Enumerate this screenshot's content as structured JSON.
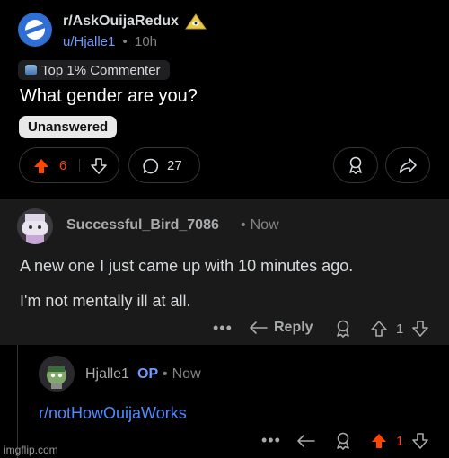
{
  "post": {
    "subreddit": "r/AskOuijaRedux",
    "username": "u/Hjalle1",
    "separator": "•",
    "age": "10h",
    "flair": "Top 1% Commenter",
    "title": "What gender are you?",
    "tag": "Unanswered",
    "vote_count": "6",
    "comment_count": "27",
    "upvoted": true
  },
  "comment": {
    "author": "Successful_Bird_7086",
    "separator": "•",
    "time": "Now",
    "line1": "A new one I just came up with 10 minutes ago.",
    "line2": "I'm not mentally ill at all.",
    "more": "•••",
    "reply_label": "Reply",
    "vote_count": "1"
  },
  "reply": {
    "author": "Hjalle1",
    "op_badge": "OP",
    "separator": "•",
    "time": "Now",
    "body": "r/notHowOuijaWorks",
    "more": "•••",
    "vote_count": "1",
    "upvoted": true
  },
  "watermark": "imgflip.com",
  "colors": {
    "upvote": "#ff4500",
    "link": "#4f8bff",
    "background": "#000000",
    "comment_bg": "#1a1a1b"
  },
  "icons": [
    "upvote-icon",
    "downvote-icon",
    "comment-bubble-icon",
    "award-icon",
    "share-icon",
    "reply-arrow-icon",
    "more-icon",
    "illuminati-icon",
    "subreddit-icon"
  ]
}
